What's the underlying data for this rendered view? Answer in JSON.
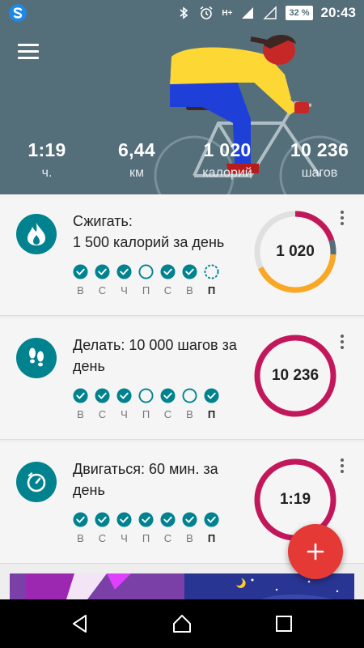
{
  "status_bar": {
    "signal": "H+",
    "battery": "32 %",
    "time": "20:43"
  },
  "hero": {
    "stats": [
      {
        "value": "1:19",
        "unit": "ч."
      },
      {
        "value": "6,44",
        "unit": "км"
      },
      {
        "value": "1 020",
        "unit": "калорий"
      },
      {
        "value": "10 236",
        "unit": "шагов"
      }
    ]
  },
  "goals": [
    {
      "icon": "flame-icon",
      "title": "Сжигать:\n1 500 калорий за день",
      "value": "1 020",
      "progress": 0.68,
      "ring_color": "#f9a825",
      "days": [
        {
          "label": "В",
          "state": "done"
        },
        {
          "label": "С",
          "state": "done"
        },
        {
          "label": "Ч",
          "state": "done"
        },
        {
          "label": "П",
          "state": "empty"
        },
        {
          "label": "С",
          "state": "done"
        },
        {
          "label": "В",
          "state": "done"
        },
        {
          "label": "П",
          "state": "partial",
          "today": true
        }
      ]
    },
    {
      "icon": "footsteps-icon",
      "title": "Делать: 10 000 шагов за день",
      "value": "10 236",
      "progress": 1.0,
      "ring_color": "#c2185b",
      "days": [
        {
          "label": "В",
          "state": "done"
        },
        {
          "label": "С",
          "state": "done"
        },
        {
          "label": "Ч",
          "state": "done"
        },
        {
          "label": "П",
          "state": "empty"
        },
        {
          "label": "С",
          "state": "done"
        },
        {
          "label": "В",
          "state": "empty"
        },
        {
          "label": "П",
          "state": "done",
          "today": true
        }
      ]
    },
    {
      "icon": "timer-icon",
      "title": "Двигаться: 60 мин. за день",
      "value": "1:19",
      "progress": 1.0,
      "ring_color": "#c2185b",
      "days": [
        {
          "label": "В",
          "state": "done"
        },
        {
          "label": "С",
          "state": "done"
        },
        {
          "label": "Ч",
          "state": "done"
        },
        {
          "label": "П",
          "state": "done"
        },
        {
          "label": "С",
          "state": "done"
        },
        {
          "label": "В",
          "state": "done"
        },
        {
          "label": "П",
          "state": "done",
          "today": true
        }
      ]
    }
  ],
  "colors": {
    "header": "#546e7a",
    "teal": "#00838f",
    "fab": "#e53935",
    "ring_track": "#e0e0e0",
    "calorie_ring_tail": "#546e7a"
  }
}
